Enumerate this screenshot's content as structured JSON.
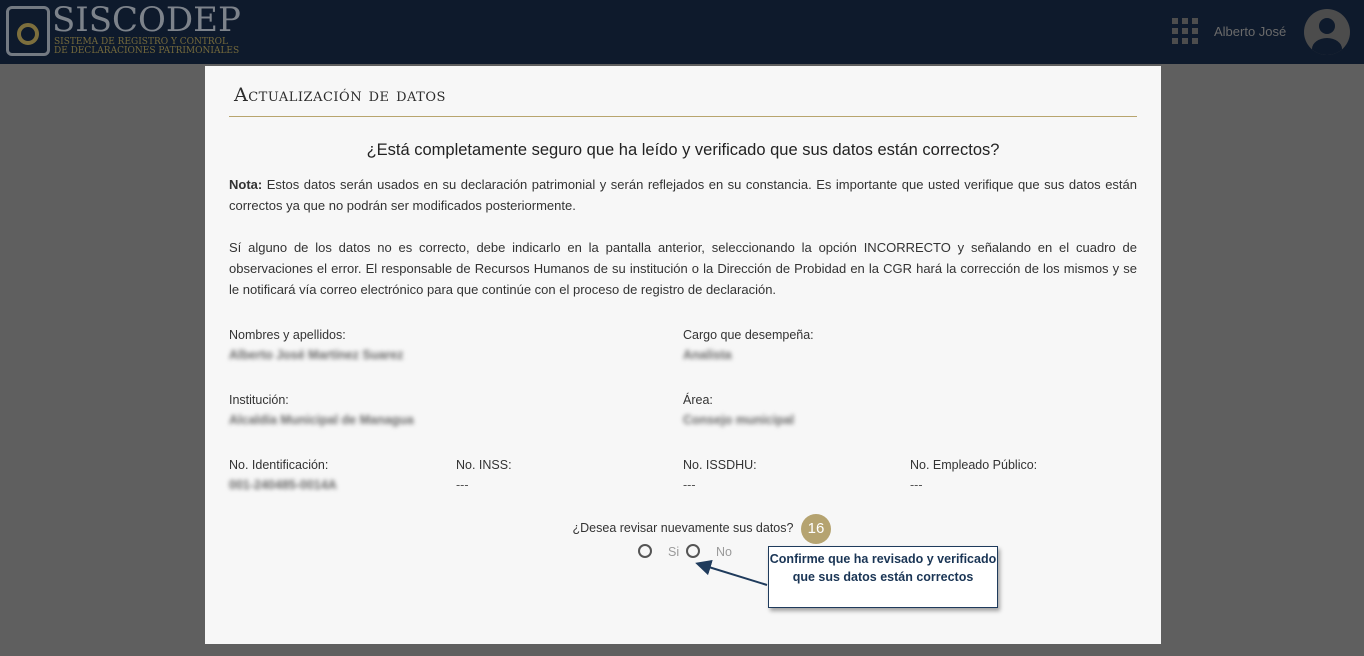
{
  "header": {
    "logo_title": "SISCODEP",
    "logo_subtitle": "Sistema de Registro y Control de Declaraciones Patrimoniales",
    "username": "Alberto José"
  },
  "modal": {
    "title": "Actualización de datos",
    "question": "¿Está completamente seguro que ha leído y verificado que sus datos están correctos?",
    "note_label": "Nota:",
    "note_text": " Estos datos serán usados en su declaración patrimonial y serán reflejados en su constancia. Es importante que usted verifique que sus datos están correctos ya que no podrán ser modificados posteriormente.",
    "paragraph2": "Sí alguno de los datos no es correcto, debe indicarlo en la pantalla anterior, seleccionando la opción INCORRECTO y señalando en el cuadro de observaciones el error. El responsable de Recursos Humanos de su institución o la Dirección de Probidad en la CGR hará la corrección de los mismos y se le notificará vía correo electrónico para que continúe con el proceso de registro de declaración.",
    "fields": {
      "nombres_label": "Nombres y apellidos:",
      "nombres_value": "Alberto José Martínez Suarez",
      "cargo_label": "Cargo que desempeña:",
      "cargo_value": "Analista",
      "institucion_label": "Institución:",
      "institucion_value": "Alcaldía Municipal de Managua",
      "area_label": "Área:",
      "area_value": "Consejo municipal",
      "identificacion_label": "No. Identificación:",
      "identificacion_value": "001-240485-0014A",
      "inss_label": "No. INSS:",
      "inss_value": "---",
      "issdhu_label": "No. ISSDHU:",
      "issdhu_value": "---",
      "empleado_label": "No. Empleado Público:",
      "empleado_value": "---"
    },
    "review_question": "¿Desea revisar nuevamente sus datos?",
    "option_yes": "Si",
    "option_no": "No",
    "step_badge": "16",
    "callout": "Confirme que ha  revisado y verificado que sus datos están correctos"
  }
}
